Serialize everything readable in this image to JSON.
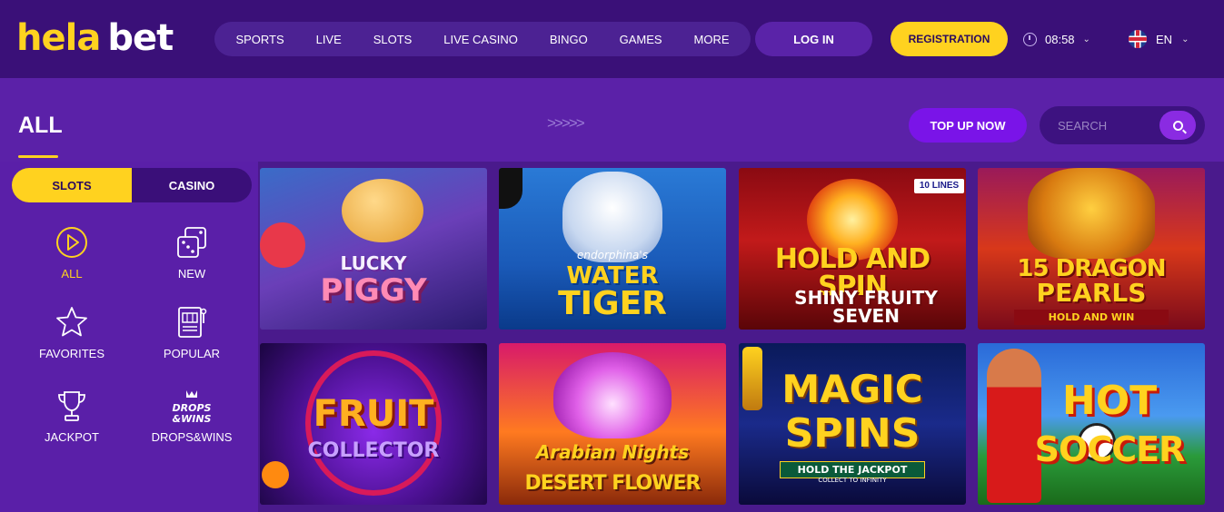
{
  "brand": {
    "part1": "hela",
    "part2": "bet"
  },
  "nav": [
    "SPORTS",
    "LIVE",
    "SLOTS",
    "LIVE CASINO",
    "BINGO",
    "GAMES",
    "MORE"
  ],
  "auth": {
    "login": "LOG IN",
    "register": "REGISTRATION"
  },
  "clock": {
    "time": "08:58"
  },
  "language": {
    "code": "EN"
  },
  "page": {
    "title": "ALL",
    "arrows": ">>>>>"
  },
  "actions": {
    "topup": "TOP UP NOW",
    "search_placeholder": "SEARCH"
  },
  "toggle": {
    "slots": "SLOTS",
    "casino": "CASINO"
  },
  "categories": [
    {
      "label": "ALL",
      "icon": "play-icon"
    },
    {
      "label": "NEW",
      "icon": "dice-icon"
    },
    {
      "label": "FAVORITES",
      "icon": "star-icon"
    },
    {
      "label": "POPULAR",
      "icon": "slot-machine-icon"
    },
    {
      "label": "JACKPOT",
      "icon": "trophy-icon"
    },
    {
      "label": "DROPS&WINS",
      "icon": "drops-wins-icon",
      "badge": "DROPS & WINS"
    }
  ],
  "games": [
    {
      "name": "Lucky Piggy",
      "line1": "LUCKY",
      "line2": "PIGGY"
    },
    {
      "name": "Water Tiger",
      "line0": "endorphina's",
      "line1": "WATER",
      "line2": "TIGER"
    },
    {
      "name": "Hold and Spin Shiny Fruity Seven",
      "line1": "HOLD AND SPIN",
      "line2": "SHINY FRUITY SEVEN",
      "badge": "10 LINES"
    },
    {
      "name": "15 Dragon Pearls",
      "line1": "15 DRAGON",
      "line2": "PEARLS",
      "line3": "HOLD AND WIN"
    },
    {
      "name": "Fruit Collector",
      "line1": "FRUIT",
      "line2": "COLLECTOR"
    },
    {
      "name": "Arabian Nights Desert Flower",
      "line1": "Arabian Nights",
      "line2": "DESERT FLOWER"
    },
    {
      "name": "Magic Spins",
      "line1": "MAGIC",
      "line2": "SPINS",
      "line3": "HOLD THE JACKPOT",
      "line4": "COLLECT TO INFINITY"
    },
    {
      "name": "Hot Soccer",
      "line1": "HOT",
      "line2": "SOCCER"
    }
  ],
  "colors": {
    "brand_yellow": "#ffd21f",
    "header_bg": "#3a1078",
    "accent_purple": "#7a14e8"
  }
}
